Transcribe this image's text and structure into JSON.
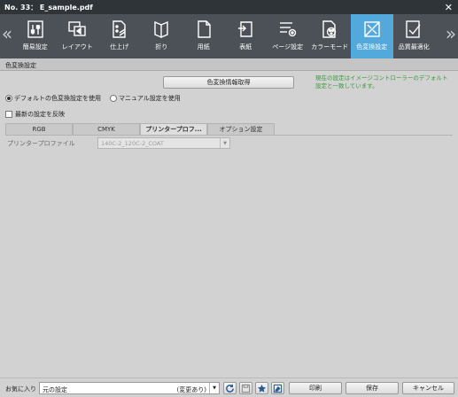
{
  "window": {
    "title": "No. 33： E_sample.pdf",
    "close_glyph": "✕"
  },
  "toolbar": {
    "left_arrow": "«",
    "right_arrow": "»",
    "active_color": "#53a8dc",
    "items": [
      {
        "label": "簡易設定",
        "icon": "simple-settings-icon"
      },
      {
        "label": "レイアウト",
        "icon": "layout-icon"
      },
      {
        "label": "仕上げ",
        "icon": "finishing-icon"
      },
      {
        "label": "折り",
        "icon": "fold-icon"
      },
      {
        "label": "用紙",
        "icon": "paper-icon"
      },
      {
        "label": "表紙",
        "icon": "cover-icon"
      },
      {
        "label": "ページ設定",
        "icon": "page-settings-icon"
      },
      {
        "label": "カラーモード",
        "icon": "color-mode-icon"
      },
      {
        "label": "色変換設定",
        "icon": "color-conversion-icon",
        "active": true
      },
      {
        "label": "品質最適化",
        "icon": "quality-optimize-icon"
      }
    ]
  },
  "section": {
    "title": "色変換設定",
    "get_info_button": "色変換情報取得",
    "info_text": "現在の設定はイメージコントローラーのデフォルト設定と一致しています。",
    "info_color": "#3a9a3a",
    "radio_default": "デフォルトの色変換設定を使用",
    "radio_manual": "マニュアル設定を使用",
    "radio_selected": "default",
    "checkbox_latest": "最新の設定を反映",
    "checkbox_checked": false,
    "tabs": [
      "RGB",
      "CMYK",
      "プリンタープロフ...",
      "オプション設定"
    ],
    "active_tab": 2,
    "printer_profile_label": "プリンタープロファイル",
    "printer_profile_value": "140C-2_120C-2_COAT"
  },
  "footer": {
    "favorites_label": "お気に入り",
    "favorites_value": "元の設定",
    "favorites_status": "(変更あり)",
    "print_button": "印刷",
    "save_button": "保存",
    "cancel_button": "キャンセル"
  }
}
